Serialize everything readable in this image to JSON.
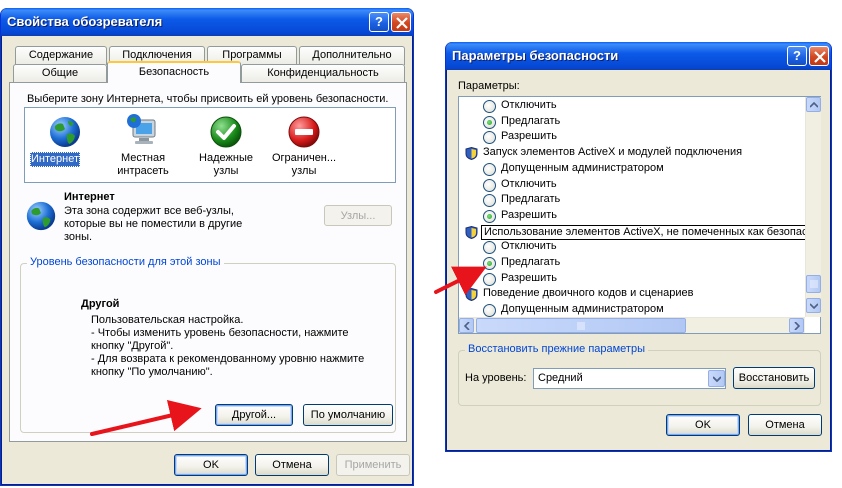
{
  "win1": {
    "title": "Свойства обозревателя",
    "tabs_row1": [
      "Содержание",
      "Подключения",
      "Программы",
      "Дополнительно"
    ],
    "tabs_row2": [
      "Общие",
      "Безопасность",
      "Конфиденциальность"
    ],
    "zone_prompt": "Выберите зону Интернета, чтобы присвоить ей уровень безопасности.",
    "zones": [
      {
        "label": "Интернет",
        "icon": "globe-icon"
      },
      {
        "label": "Местная интрасеть",
        "icon": "monitor-globe-icon"
      },
      {
        "label": "Надежные узлы",
        "icon": "green-check-icon"
      },
      {
        "label": "Ограничен... узлы",
        "icon": "red-stop-icon"
      }
    ],
    "zone_title": "Интернет",
    "zone_desc": "Эта зона содержит все веб-узлы, которые вы не поместили в другие зоны.",
    "sites_button": "Узлы...",
    "level_group_title": "Уровень безопасности для этой зоны",
    "level_name": "Другой",
    "level_desc": "Пользовательская настройка.\n- Чтобы изменить уровень безопасности, нажмите кнопку \"Другой\".\n- Для возврата к рекомендованному уровню нажмите кнопку \"По умолчанию\".",
    "custom_button": "Другой...",
    "default_button": "По умолчанию",
    "ok": "OK",
    "cancel": "Отмена",
    "apply": "Применить"
  },
  "win2": {
    "title": "Параметры безопасности",
    "params_label": "Параметры:",
    "items": [
      {
        "type": "radio",
        "label": "Отключить",
        "checked": false
      },
      {
        "type": "radio",
        "label": "Предлагать",
        "checked": true
      },
      {
        "type": "radio",
        "label": "Разрешить",
        "checked": false
      },
      {
        "type": "header",
        "label": "Запуск элементов ActiveX и модулей подключения"
      },
      {
        "type": "radio",
        "label": "Допущенным администратором",
        "checked": false
      },
      {
        "type": "radio",
        "label": "Отключить",
        "checked": false
      },
      {
        "type": "radio",
        "label": "Предлагать",
        "checked": false
      },
      {
        "type": "radio",
        "label": "Разрешить",
        "checked": true
      },
      {
        "type": "header",
        "label": "Использование элементов ActiveX, не помеченных как безопасные"
      },
      {
        "type": "radio",
        "label": "Отключить",
        "checked": false
      },
      {
        "type": "radio",
        "label": "Предлагать",
        "checked": true
      },
      {
        "type": "radio",
        "label": "Разрешить",
        "checked": false
      },
      {
        "type": "header",
        "label": "Поведение двоичного кодов и сценариев"
      },
      {
        "type": "radio",
        "label": "Допущенным администратором",
        "checked": false
      }
    ],
    "reset_group_title": "Восстановить прежние параметры",
    "level_label": "На уровень:",
    "level_value": "Средний",
    "restore_button": "Восстановить",
    "ok": "OK",
    "cancel": "Отмена"
  },
  "colors": {
    "arrow": "#e8141b",
    "group_title": "#0046d5",
    "titlebar": "#0648d6"
  }
}
